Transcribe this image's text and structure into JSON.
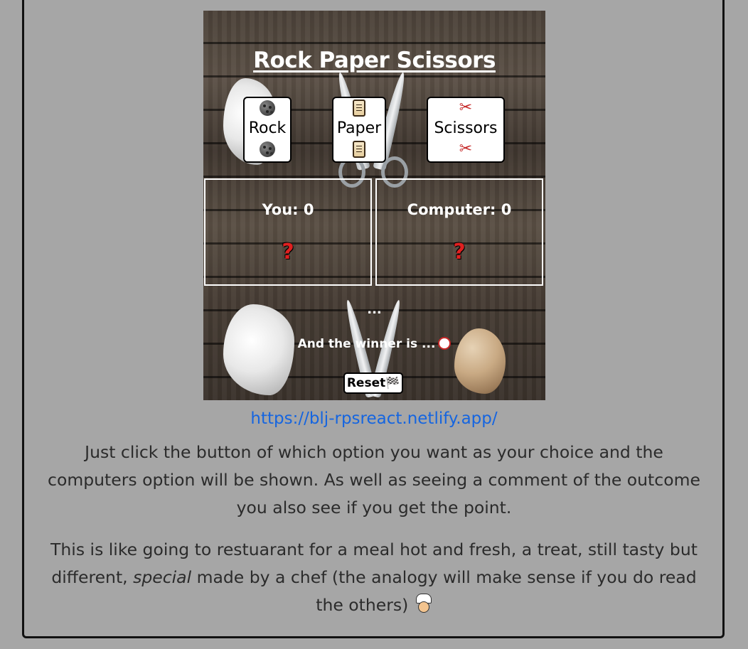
{
  "project": {
    "screenshot": {
      "title": "Rock Paper Scissors",
      "choices": [
        {
          "label": "Rock",
          "icon": "rock-icon"
        },
        {
          "label": "Paper",
          "icon": "scroll-icon"
        },
        {
          "label": "Scissors",
          "icon": "scissors-icon"
        }
      ],
      "you_score": "You: 0",
      "computer_score": "Computer: 0",
      "you_choice": "?",
      "computer_choice": "?",
      "status": "...",
      "winner_text": "And the winner is ...",
      "reset_label": "Reset"
    },
    "link": "https://blj-rpsreact.netlify.app/",
    "description": "Just click the button of which option you want as your choice and the computers option will be shown. As well as seeing a comment of the outcome you also see if you get the point.",
    "analogy_before": "This is like going to restuarant for a meal hot and fresh, a treat, still tasty but different, ",
    "analogy_em": "special",
    "analogy_after": " made by a chef (the analogy will make sense if you do read the others) ",
    "colors": {
      "page_bg": "#a6a6a6",
      "link": "#1565e0",
      "text": "#2b2b2b"
    }
  }
}
